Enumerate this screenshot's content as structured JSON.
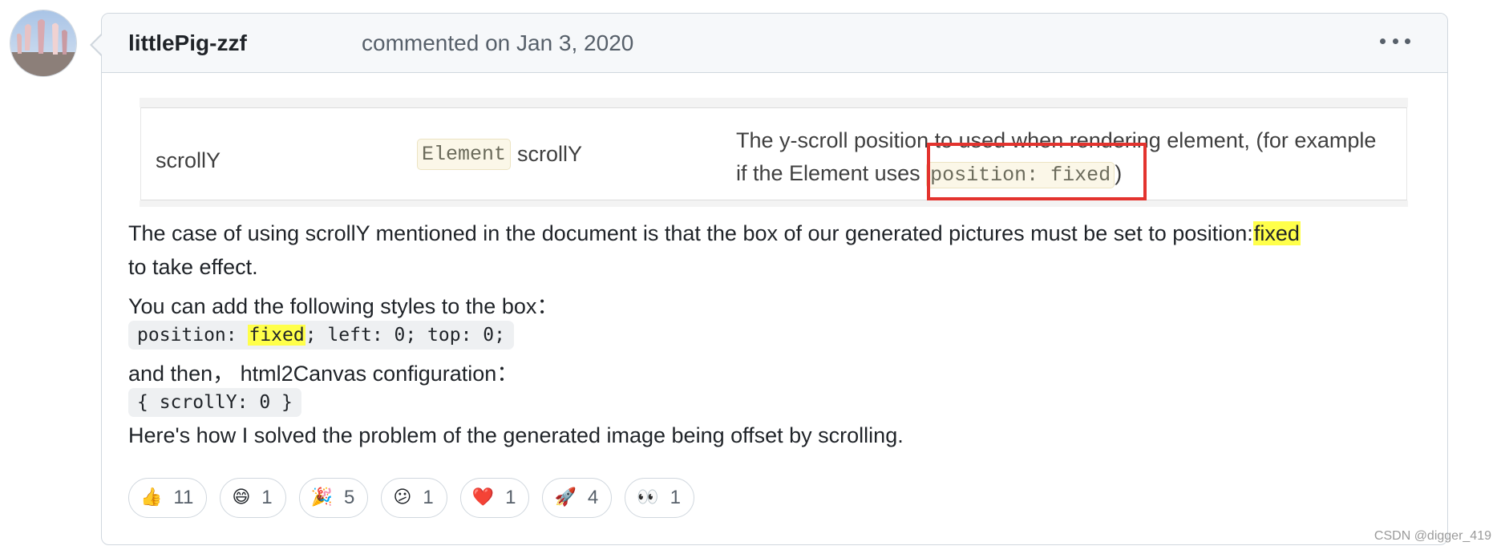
{
  "comment": {
    "author": "littlePig-zzf",
    "action": "commented on",
    "date": "Jan 3, 2020"
  },
  "doc_table_row": {
    "name": "scrollY",
    "type_code": "Element",
    "type_text": "scrollY",
    "desc_part1": "The y-scroll position to used when rendering element, (for example",
    "desc_part2": "if the Element uses",
    "desc_code": "position: fixed",
    "desc_end": ")"
  },
  "body": {
    "line1_text": "The case of using scrollY mentioned in the document is that the box of our generated pictures must be set to position:",
    "line1_mark": "fixed",
    "line2": "to take effect.",
    "line3": "You can add the following styles to the box：",
    "code1_before": "position: ",
    "code1_mark": "fixed",
    "code1_after": "; left: 0; top: 0;",
    "line4": "and then， html2Canvas configuration：",
    "code2": "{ scrollY: 0 }",
    "line5": "Here's how I solved the problem of the generated image being offset by scrolling."
  },
  "reactions": [
    {
      "icon": "thumbs-up",
      "glyph": "👍",
      "count": "11"
    },
    {
      "icon": "laugh",
      "glyph": "😄",
      "count": "1"
    },
    {
      "icon": "hooray",
      "glyph": "🎉",
      "count": "5"
    },
    {
      "icon": "confused",
      "glyph": "😕",
      "count": "1"
    },
    {
      "icon": "heart",
      "glyph": "❤️",
      "count": "1"
    },
    {
      "icon": "rocket",
      "glyph": "🚀",
      "count": "4"
    },
    {
      "icon": "eyes",
      "glyph": "👀",
      "count": "1"
    }
  ],
  "watermark": "CSDN @digger_419"
}
